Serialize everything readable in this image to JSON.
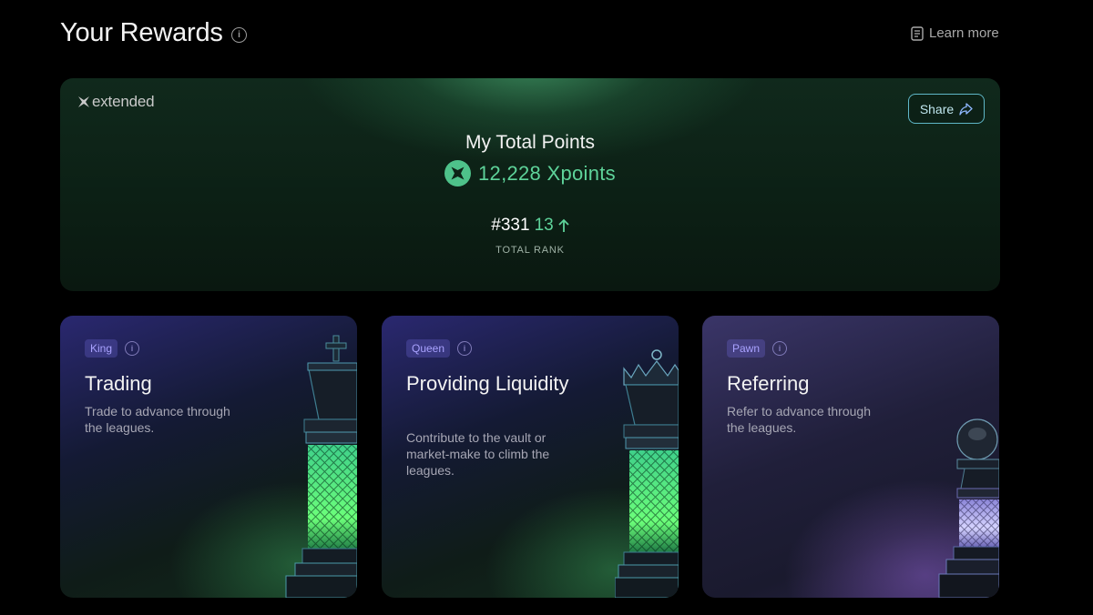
{
  "header": {
    "title": "Your Rewards",
    "learn_more": "Learn more"
  },
  "hero": {
    "brand": "extended",
    "share_label": "Share",
    "title": "My Total Points",
    "points": "12,228 Xpoints",
    "rank": "#331",
    "rank_change": "13",
    "rank_label": "TOTAL RANK"
  },
  "cards": [
    {
      "badge": "King",
      "title": "Trading",
      "description": "Trade to advance through the leagues."
    },
    {
      "badge": "Queen",
      "title": "Providing Liquidity",
      "description": "Contribute to the vault or market-make to climb the leagues."
    },
    {
      "badge": "Pawn",
      "title": "Referring",
      "description": "Refer to advance through the leagues."
    }
  ],
  "colors": {
    "accent_green": "#5ed39a",
    "badge_purple": "#a9a2ff",
    "share_border": "#5fb7c8"
  }
}
